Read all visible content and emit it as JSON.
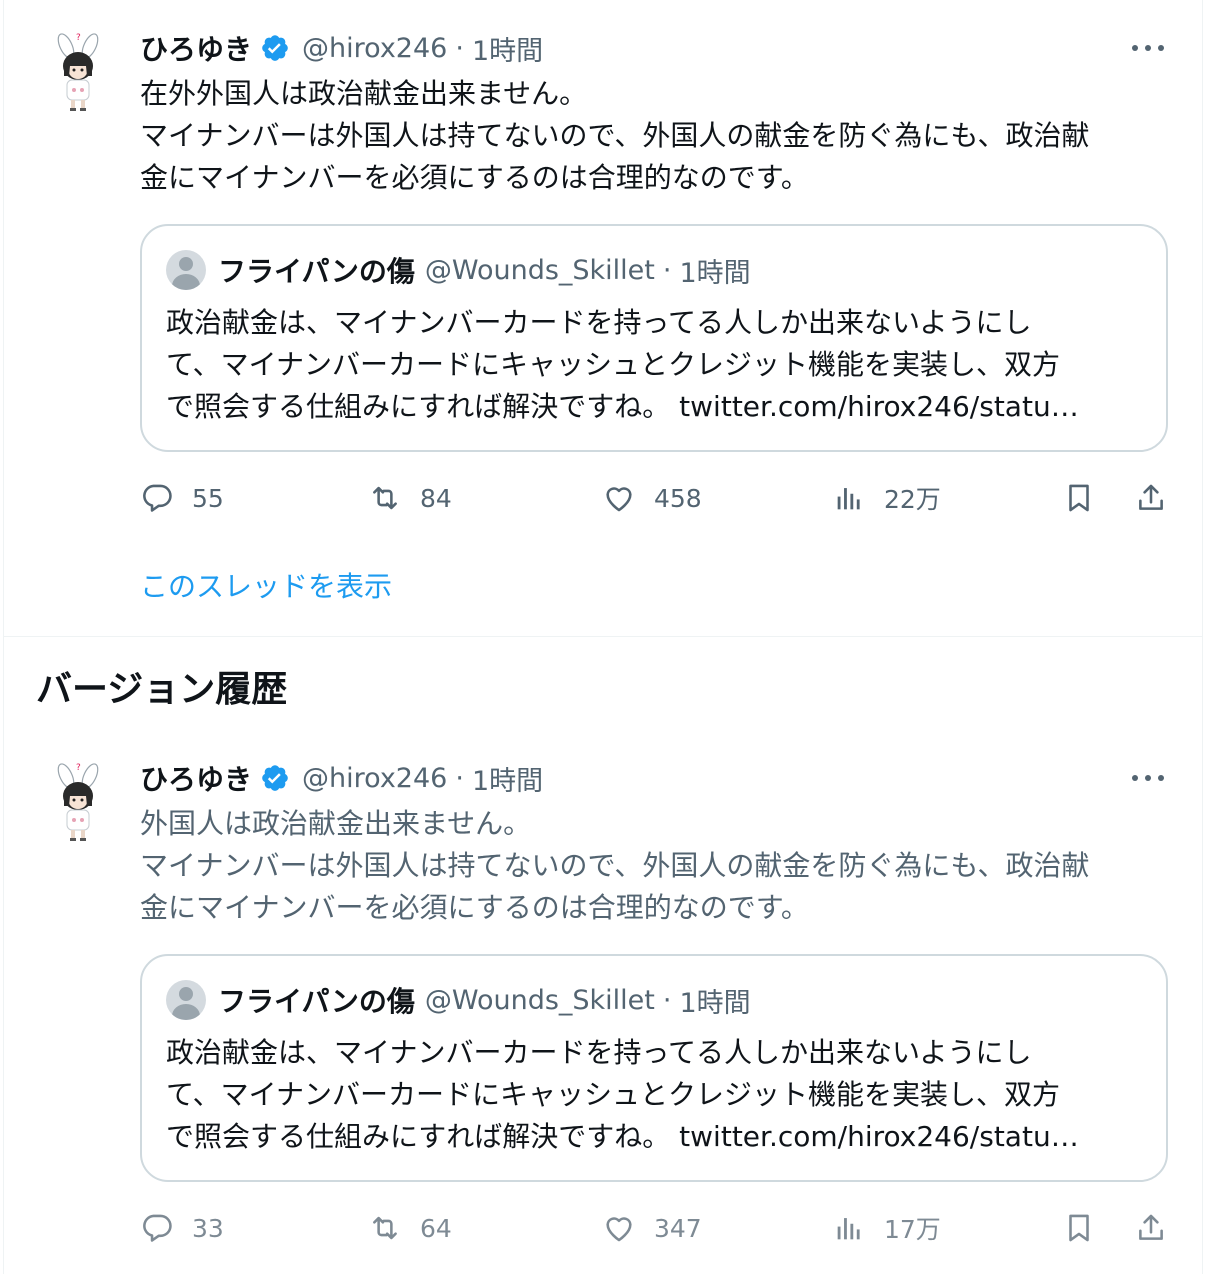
{
  "current_tweet": {
    "author": {
      "name": "ひろゆき",
      "handle": "@hirox246",
      "separator": "·",
      "time": "1時間"
    },
    "text_lines": [
      "在外外国人は政治献金出来ません。",
      "マイナンバーは外国人は持てないので、外国人の献金を防ぐ為にも、政治献",
      "金にマイナンバーを必須にするのは合理的なのです。"
    ],
    "quote": {
      "name": "フライパンの傷",
      "handle": "@Wounds_Skillet",
      "separator": "·",
      "time": "1時間",
      "text_lines": [
        "政治献金は、マイナンバーカードを持ってる人しか出来ないようにし",
        "て、マイナンバーカードにキャッシュとクレジット機能を実装し、双方",
        "で照会する仕組みにすれば解決ですね。 twitter.com/hirox246/statu…"
      ]
    },
    "stats": {
      "replies": "55",
      "retweets": "84",
      "likes": "458",
      "views": "22万"
    },
    "show_thread": "このスレッドを表示"
  },
  "version_history": {
    "title": "バージョン履歴",
    "tweet": {
      "author": {
        "name": "ひろゆき",
        "handle": "@hirox246",
        "separator": "·",
        "time": "1時間"
      },
      "text_lines": [
        "外国人は政治献金出来ません。",
        "マイナンバーは外国人は持てないので、外国人の献金を防ぐ為にも、政治献",
        "金にマイナンバーを必須にするのは合理的なのです。"
      ],
      "quote": {
        "name": "フライパンの傷",
        "handle": "@Wounds_Skillet",
        "separator": "·",
        "time": "1時間",
        "text_lines": [
          "政治献金は、マイナンバーカードを持ってる人しか出来ないようにし",
          "て、マイナンバーカードにキャッシュとクレジット機能を実装し、双方",
          "で照会する仕組みにすれば解決ですね。 twitter.com/hirox246/statu…"
        ]
      },
      "stats": {
        "replies": "33",
        "retweets": "64",
        "likes": "347",
        "views": "17万"
      }
    }
  },
  "icons": {
    "verified": "verified-badge-icon",
    "more": "more-options-icon",
    "reply": "reply-icon",
    "retweet": "retweet-icon",
    "like": "like-icon",
    "views": "views-icon",
    "bookmark": "bookmark-icon",
    "share": "share-icon"
  },
  "colors": {
    "text": "#0f1419",
    "secondary": "#536471",
    "link": "#1d9bf0",
    "verified": "#1d9bf0",
    "border": "#cfd9de"
  }
}
